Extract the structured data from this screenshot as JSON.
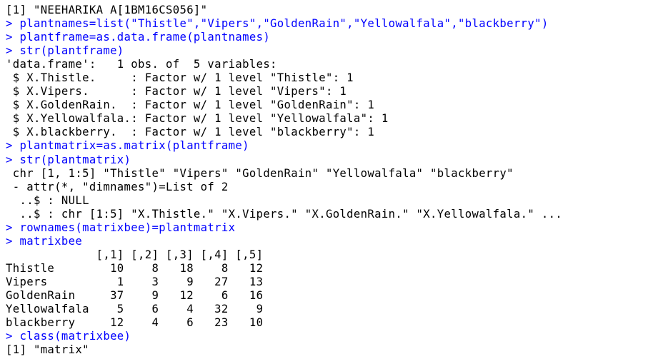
{
  "console": {
    "colors": {
      "command": "#0000ff",
      "output": "#000000",
      "background": "#ffffff"
    },
    "lines": [
      {
        "kind": "output",
        "text": "[1] \"NEEHARIKA A[1BM16CS056]\""
      },
      {
        "kind": "command",
        "text": "> plantnames=list(\"Thistle\",\"Vipers\",\"GoldenRain\",\"Yellowalfala\",\"blackberry\")"
      },
      {
        "kind": "command",
        "text": "> plantframe=as.data.frame(plantnames)"
      },
      {
        "kind": "command",
        "text": "> str(plantframe)"
      },
      {
        "kind": "output",
        "text": "'data.frame':   1 obs. of  5 variables:"
      },
      {
        "kind": "output",
        "text": " $ X.Thistle.     : Factor w/ 1 level \"Thistle\": 1"
      },
      {
        "kind": "output",
        "text": " $ X.Vipers.      : Factor w/ 1 level \"Vipers\": 1"
      },
      {
        "kind": "output",
        "text": " $ X.GoldenRain.  : Factor w/ 1 level \"GoldenRain\": 1"
      },
      {
        "kind": "output",
        "text": " $ X.Yellowalfala.: Factor w/ 1 level \"Yellowalfala\": 1"
      },
      {
        "kind": "output",
        "text": " $ X.blackberry.  : Factor w/ 1 level \"blackberry\": 1"
      },
      {
        "kind": "command",
        "text": "> plantmatrix=as.matrix(plantframe)"
      },
      {
        "kind": "command",
        "text": "> str(plantmatrix)"
      },
      {
        "kind": "output",
        "text": " chr [1, 1:5] \"Thistle\" \"Vipers\" \"GoldenRain\" \"Yellowalfala\" \"blackberry\""
      },
      {
        "kind": "output",
        "text": " - attr(*, \"dimnames\")=List of 2"
      },
      {
        "kind": "output",
        "text": "  ..$ : NULL"
      },
      {
        "kind": "output",
        "text": "  ..$ : chr [1:5] \"X.Thistle.\" \"X.Vipers.\" \"X.GoldenRain.\" \"X.Yellowalfala.\" ..."
      },
      {
        "kind": "command",
        "text": "> rownames(matrixbee)=plantmatrix"
      },
      {
        "kind": "command",
        "text": "> matrixbee"
      },
      {
        "kind": "output",
        "text": "             [,1] [,2] [,3] [,4] [,5]"
      },
      {
        "kind": "output",
        "text": "Thistle        10    8   18    8   12"
      },
      {
        "kind": "output",
        "text": "Vipers          1    3    9   27   13"
      },
      {
        "kind": "output",
        "text": "GoldenRain     37    9   12    6   16"
      },
      {
        "kind": "output",
        "text": "Yellowalfala    5    6    4   32    9"
      },
      {
        "kind": "output",
        "text": "blackberry     12    4    6   23   10"
      },
      {
        "kind": "command",
        "text": "> class(matrixbee)"
      },
      {
        "kind": "output",
        "text": "[1] \"matrix\""
      }
    ]
  }
}
